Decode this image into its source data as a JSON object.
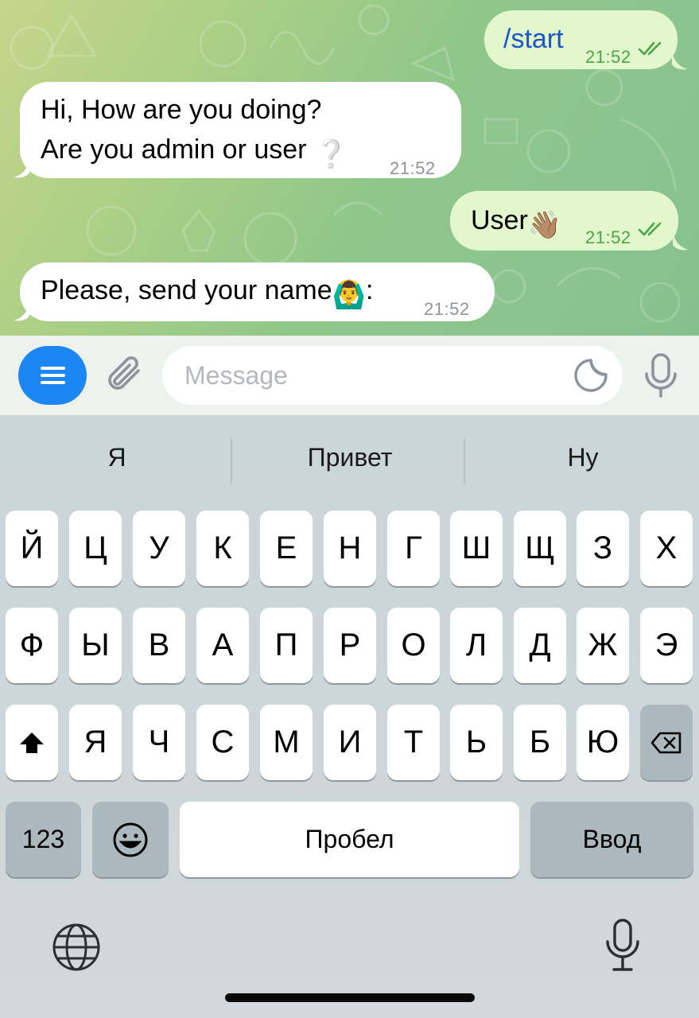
{
  "chat": {
    "messages": [
      {
        "direction": "outgoing",
        "text": "/start",
        "time": "21:52",
        "status": "read"
      },
      {
        "direction": "incoming",
        "lines": [
          "Hi, How are you doing?",
          "Are you admin or user"
        ],
        "emoji": "❔",
        "time": "21:52"
      },
      {
        "direction": "outgoing",
        "text": "User",
        "emoji": "👋🏽",
        "time": "21:52",
        "status": "read"
      },
      {
        "direction": "incoming",
        "text": "Please, send your name",
        "emoji": "🙆‍♂️",
        "suffix": ":",
        "time": "21:52"
      }
    ]
  },
  "input_bar": {
    "placeholder": "Message",
    "menu_icon": "menu-icon",
    "attach_icon": "paperclip-icon",
    "sticker_icon": "sticker-icon",
    "mic_icon": "microphone-icon"
  },
  "keyboard": {
    "suggestions": [
      "Я",
      "Привет",
      "Ну"
    ],
    "row1": [
      "Й",
      "Ц",
      "У",
      "К",
      "Е",
      "Н",
      "Г",
      "Ш",
      "Щ",
      "З",
      "Х"
    ],
    "row2": [
      "Ф",
      "Ы",
      "В",
      "А",
      "П",
      "Р",
      "О",
      "Л",
      "Д",
      "Ж",
      "Э"
    ],
    "row3": [
      "Я",
      "Ч",
      "С",
      "М",
      "И",
      "Т",
      "Ь",
      "Б",
      "Ю"
    ],
    "shift_icon": "shift-icon",
    "backspace_icon": "backspace-icon",
    "numbers_label": "123",
    "emoji_icon": "emoji-icon",
    "space_label": "Пробел",
    "return_label": "Ввод",
    "globe_icon": "globe-icon",
    "dictation_icon": "microphone-icon"
  },
  "colors": {
    "outgoing_bubble": "#e2f7cb",
    "incoming_bubble": "#ffffff",
    "command_text": "#1a56c9",
    "read_ticks": "#4aa646",
    "menu_button": "#1d86f5"
  }
}
